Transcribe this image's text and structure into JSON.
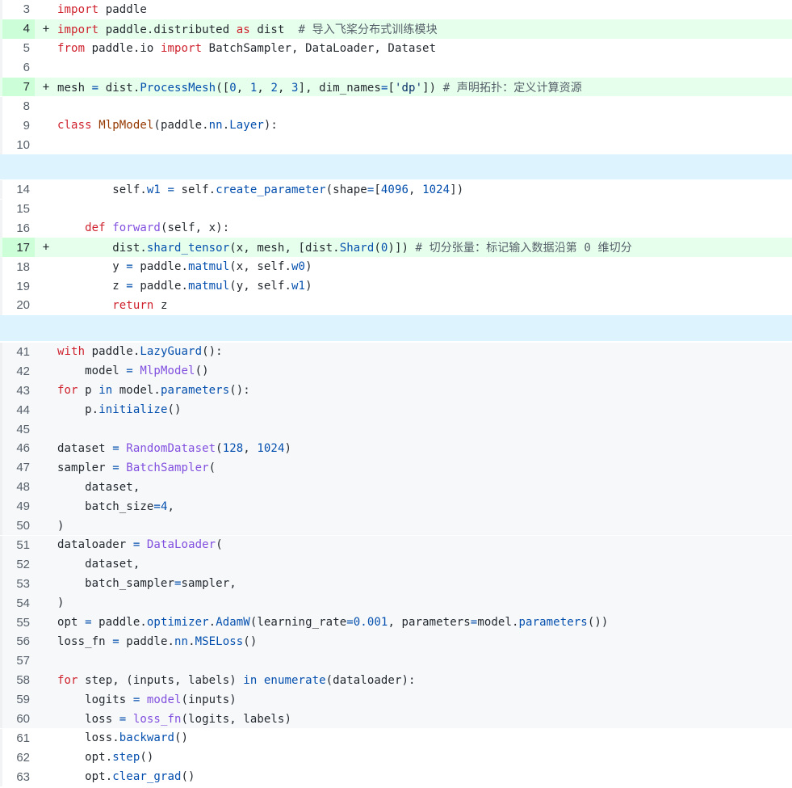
{
  "lines": [
    {
      "num": "3",
      "type": "ctx",
      "tokens": [
        {
          "t": "import",
          "c": "kw"
        },
        {
          "t": " paddle",
          "c": "ptxt"
        }
      ]
    },
    {
      "num": "4",
      "type": "add",
      "tokens": [
        {
          "t": "import",
          "c": "kw"
        },
        {
          "t": " paddle.distributed ",
          "c": "ptxt"
        },
        {
          "t": "as",
          "c": "kw"
        },
        {
          "t": " dist  ",
          "c": "ptxt"
        },
        {
          "t": "# 导入飞桨分布式训练模块",
          "c": "cm"
        }
      ]
    },
    {
      "num": "5",
      "type": "ctx",
      "tokens": [
        {
          "t": "from",
          "c": "kw"
        },
        {
          "t": " paddle.io ",
          "c": "ptxt"
        },
        {
          "t": "import",
          "c": "kw"
        },
        {
          "t": " BatchSampler, DataLoader, Dataset",
          "c": "ptxt"
        }
      ]
    },
    {
      "num": "6",
      "type": "ctx",
      "tokens": []
    },
    {
      "num": "7",
      "type": "add",
      "tokens": [
        {
          "t": "mesh ",
          "c": "ptxt"
        },
        {
          "t": "=",
          "c": "pr"
        },
        {
          "t": " dist.",
          "c": "ptxt"
        },
        {
          "t": "ProcessMesh",
          "c": "pr"
        },
        {
          "t": "([",
          "c": "ptxt"
        },
        {
          "t": "0",
          "c": "num-lit"
        },
        {
          "t": ", ",
          "c": "ptxt"
        },
        {
          "t": "1",
          "c": "num-lit"
        },
        {
          "t": ", ",
          "c": "ptxt"
        },
        {
          "t": "2",
          "c": "num-lit"
        },
        {
          "t": ", ",
          "c": "ptxt"
        },
        {
          "t": "3",
          "c": "num-lit"
        },
        {
          "t": "], dim_names",
          "c": "ptxt"
        },
        {
          "t": "=",
          "c": "pr"
        },
        {
          "t": "[",
          "c": "ptxt"
        },
        {
          "t": "'dp'",
          "c": "str"
        },
        {
          "t": "]) ",
          "c": "ptxt"
        },
        {
          "t": "# 声明拓扑：定义计算资源",
          "c": "cm"
        }
      ]
    },
    {
      "num": "8",
      "type": "ctx",
      "tokens": []
    },
    {
      "num": "9",
      "type": "ctx",
      "tokens": [
        {
          "t": "class",
          "c": "kw"
        },
        {
          "t": " ",
          "c": "ptxt"
        },
        {
          "t": "MlpModel",
          "c": "cls"
        },
        {
          "t": "(paddle.",
          "c": "ptxt"
        },
        {
          "t": "nn",
          "c": "pr"
        },
        {
          "t": ".",
          "c": "ptxt"
        },
        {
          "t": "Layer",
          "c": "pr"
        },
        {
          "t": "):",
          "c": "ptxt"
        }
      ]
    },
    {
      "num": "10",
      "type": "ctx",
      "tokens": []
    },
    {
      "num": "14",
      "type": "ctx",
      "tokens": [
        {
          "t": "        self.",
          "c": "ptxt"
        },
        {
          "t": "w1",
          "c": "pr"
        },
        {
          "t": " ",
          "c": "ptxt"
        },
        {
          "t": "=",
          "c": "pr"
        },
        {
          "t": " self.",
          "c": "ptxt"
        },
        {
          "t": "create_parameter",
          "c": "pr"
        },
        {
          "t": "(shape",
          "c": "ptxt"
        },
        {
          "t": "=",
          "c": "pr"
        },
        {
          "t": "[",
          "c": "ptxt"
        },
        {
          "t": "4096",
          "c": "num-lit"
        },
        {
          "t": ", ",
          "c": "ptxt"
        },
        {
          "t": "1024",
          "c": "num-lit"
        },
        {
          "t": "])",
          "c": "ptxt"
        }
      ]
    },
    {
      "num": "15",
      "type": "ctx",
      "tokens": []
    },
    {
      "num": "16",
      "type": "ctx",
      "tokens": [
        {
          "t": "    ",
          "c": "ptxt"
        },
        {
          "t": "def",
          "c": "kw"
        },
        {
          "t": " ",
          "c": "ptxt"
        },
        {
          "t": "forward",
          "c": "fn"
        },
        {
          "t": "(self, x):",
          "c": "ptxt"
        }
      ]
    },
    {
      "num": "17",
      "type": "add",
      "tokens": [
        {
          "t": "        dist.",
          "c": "ptxt"
        },
        {
          "t": "shard_tensor",
          "c": "pr"
        },
        {
          "t": "(x, mesh, [dist.",
          "c": "ptxt"
        },
        {
          "t": "Shard",
          "c": "pr"
        },
        {
          "t": "(",
          "c": "ptxt"
        },
        {
          "t": "0",
          "c": "num-lit"
        },
        {
          "t": ")]) ",
          "c": "ptxt"
        },
        {
          "t": "# 切分张量：标记输入数据沿第 0 维切分",
          "c": "cm"
        }
      ]
    },
    {
      "num": "18",
      "type": "ctx",
      "tokens": [
        {
          "t": "        y ",
          "c": "ptxt"
        },
        {
          "t": "=",
          "c": "pr"
        },
        {
          "t": " paddle.",
          "c": "ptxt"
        },
        {
          "t": "matmul",
          "c": "pr"
        },
        {
          "t": "(x, self.",
          "c": "ptxt"
        },
        {
          "t": "w0",
          "c": "pr"
        },
        {
          "t": ")",
          "c": "ptxt"
        }
      ]
    },
    {
      "num": "19",
      "type": "ctx",
      "tokens": [
        {
          "t": "        z ",
          "c": "ptxt"
        },
        {
          "t": "=",
          "c": "pr"
        },
        {
          "t": " paddle.",
          "c": "ptxt"
        },
        {
          "t": "matmul",
          "c": "pr"
        },
        {
          "t": "(y, self.",
          "c": "ptxt"
        },
        {
          "t": "w1",
          "c": "pr"
        },
        {
          "t": ")",
          "c": "ptxt"
        }
      ]
    },
    {
      "num": "20",
      "type": "ctx",
      "tokens": [
        {
          "t": "        ",
          "c": "ptxt"
        },
        {
          "t": "return",
          "c": "kw"
        },
        {
          "t": " z",
          "c": "ptxt"
        }
      ]
    },
    {
      "num": "41",
      "type": "ctx",
      "grey": true,
      "tokens": [
        {
          "t": "with",
          "c": "kw"
        },
        {
          "t": " paddle.",
          "c": "ptxt"
        },
        {
          "t": "LazyGuard",
          "c": "pr"
        },
        {
          "t": "():",
          "c": "ptxt"
        }
      ]
    },
    {
      "num": "42",
      "type": "ctx",
      "grey": true,
      "tokens": [
        {
          "t": "    model ",
          "c": "ptxt"
        },
        {
          "t": "=",
          "c": "pr"
        },
        {
          "t": " ",
          "c": "ptxt"
        },
        {
          "t": "MlpModel",
          "c": "fn"
        },
        {
          "t": "()",
          "c": "ptxt"
        }
      ]
    },
    {
      "num": "43",
      "type": "ctx",
      "grey": true,
      "tokens": [
        {
          "t": "for",
          "c": "kw"
        },
        {
          "t": " p ",
          "c": "ptxt"
        },
        {
          "t": "in",
          "c": "pr"
        },
        {
          "t": " model.",
          "c": "ptxt"
        },
        {
          "t": "parameters",
          "c": "pr"
        },
        {
          "t": "():",
          "c": "ptxt"
        }
      ]
    },
    {
      "num": "44",
      "type": "ctx",
      "grey": true,
      "tokens": [
        {
          "t": "    p.",
          "c": "ptxt"
        },
        {
          "t": "initialize",
          "c": "pr"
        },
        {
          "t": "()",
          "c": "ptxt"
        }
      ]
    },
    {
      "num": "45",
      "type": "ctx",
      "grey": true,
      "tokens": []
    },
    {
      "num": "46",
      "type": "ctx",
      "grey": true,
      "tokens": [
        {
          "t": "dataset ",
          "c": "ptxt"
        },
        {
          "t": "=",
          "c": "pr"
        },
        {
          "t": " ",
          "c": "ptxt"
        },
        {
          "t": "RandomDataset",
          "c": "fn"
        },
        {
          "t": "(",
          "c": "ptxt"
        },
        {
          "t": "128",
          "c": "num-lit"
        },
        {
          "t": ", ",
          "c": "ptxt"
        },
        {
          "t": "1024",
          "c": "num-lit"
        },
        {
          "t": ")",
          "c": "ptxt"
        }
      ]
    },
    {
      "num": "47",
      "type": "ctx",
      "grey": true,
      "tokens": [
        {
          "t": "sampler ",
          "c": "ptxt"
        },
        {
          "t": "=",
          "c": "pr"
        },
        {
          "t": " ",
          "c": "ptxt"
        },
        {
          "t": "BatchSampler",
          "c": "fn"
        },
        {
          "t": "(",
          "c": "ptxt"
        }
      ]
    },
    {
      "num": "48",
      "type": "ctx",
      "grey": true,
      "tokens": [
        {
          "t": "    dataset,",
          "c": "ptxt"
        }
      ]
    },
    {
      "num": "49",
      "type": "ctx",
      "grey": true,
      "tokens": [
        {
          "t": "    batch_size",
          "c": "ptxt"
        },
        {
          "t": "=",
          "c": "pr"
        },
        {
          "t": "4",
          "c": "num-lit"
        },
        {
          "t": ",",
          "c": "ptxt"
        }
      ]
    },
    {
      "num": "50",
      "type": "ctx",
      "grey": true,
      "tokens": [
        {
          "t": ")",
          "c": "ptxt"
        }
      ]
    },
    {
      "num": "51",
      "type": "ctx",
      "grey": true,
      "tokens": [
        {
          "t": "dataloader ",
          "c": "ptxt"
        },
        {
          "t": "=",
          "c": "pr"
        },
        {
          "t": " ",
          "c": "ptxt"
        },
        {
          "t": "DataLoader",
          "c": "fn"
        },
        {
          "t": "(",
          "c": "ptxt"
        }
      ]
    },
    {
      "num": "52",
      "type": "ctx",
      "grey": true,
      "tokens": [
        {
          "t": "    dataset,",
          "c": "ptxt"
        }
      ]
    },
    {
      "num": "53",
      "type": "ctx",
      "grey": true,
      "tokens": [
        {
          "t": "    batch_sampler",
          "c": "ptxt"
        },
        {
          "t": "=",
          "c": "pr"
        },
        {
          "t": "sampler,",
          "c": "ptxt"
        }
      ]
    },
    {
      "num": "54",
      "type": "ctx",
      "grey": true,
      "tokens": [
        {
          "t": ")",
          "c": "ptxt"
        }
      ]
    },
    {
      "num": "55",
      "type": "ctx",
      "grey": true,
      "tokens": [
        {
          "t": "opt ",
          "c": "ptxt"
        },
        {
          "t": "=",
          "c": "pr"
        },
        {
          "t": " paddle.",
          "c": "ptxt"
        },
        {
          "t": "optimizer",
          "c": "pr"
        },
        {
          "t": ".",
          "c": "ptxt"
        },
        {
          "t": "AdamW",
          "c": "pr"
        },
        {
          "t": "(learning_rate",
          "c": "ptxt"
        },
        {
          "t": "=",
          "c": "pr"
        },
        {
          "t": "0.001",
          "c": "num-lit"
        },
        {
          "t": ", parameters",
          "c": "ptxt"
        },
        {
          "t": "=",
          "c": "pr"
        },
        {
          "t": "model.",
          "c": "ptxt"
        },
        {
          "t": "parameters",
          "c": "pr"
        },
        {
          "t": "())",
          "c": "ptxt"
        }
      ]
    },
    {
      "num": "56",
      "type": "ctx",
      "grey": true,
      "tokens": [
        {
          "t": "loss_fn ",
          "c": "ptxt"
        },
        {
          "t": "=",
          "c": "pr"
        },
        {
          "t": " paddle.",
          "c": "ptxt"
        },
        {
          "t": "nn",
          "c": "pr"
        },
        {
          "t": ".",
          "c": "ptxt"
        },
        {
          "t": "MSELoss",
          "c": "pr"
        },
        {
          "t": "()",
          "c": "ptxt"
        }
      ]
    },
    {
      "num": "57",
      "type": "ctx",
      "grey": true,
      "tokens": []
    },
    {
      "num": "58",
      "type": "ctx",
      "grey": true,
      "tokens": [
        {
          "t": "for",
          "c": "kw"
        },
        {
          "t": " step, (inputs, labels) ",
          "c": "ptxt"
        },
        {
          "t": "in",
          "c": "pr"
        },
        {
          "t": " ",
          "c": "ptxt"
        },
        {
          "t": "enumerate",
          "c": "pr"
        },
        {
          "t": "(dataloader):",
          "c": "ptxt"
        }
      ]
    },
    {
      "num": "59",
      "type": "ctx",
      "grey": true,
      "tokens": [
        {
          "t": "    logits ",
          "c": "ptxt"
        },
        {
          "t": "=",
          "c": "pr"
        },
        {
          "t": " ",
          "c": "ptxt"
        },
        {
          "t": "model",
          "c": "fn"
        },
        {
          "t": "(inputs)",
          "c": "ptxt"
        }
      ]
    },
    {
      "num": "60",
      "type": "ctx",
      "grey": true,
      "tokens": [
        {
          "t": "    loss ",
          "c": "ptxt"
        },
        {
          "t": "=",
          "c": "pr"
        },
        {
          "t": " ",
          "c": "ptxt"
        },
        {
          "t": "loss_fn",
          "c": "fn"
        },
        {
          "t": "(logits, labels)",
          "c": "ptxt"
        }
      ]
    },
    {
      "num": "61",
      "type": "ctx",
      "tokens": [
        {
          "t": "    loss.",
          "c": "ptxt"
        },
        {
          "t": "backward",
          "c": "pr"
        },
        {
          "t": "()",
          "c": "ptxt"
        }
      ]
    },
    {
      "num": "62",
      "type": "ctx",
      "tokens": [
        {
          "t": "    opt.",
          "c": "ptxt"
        },
        {
          "t": "step",
          "c": "pr"
        },
        {
          "t": "()",
          "c": "ptxt"
        }
      ]
    },
    {
      "num": "63",
      "type": "ctx",
      "tokens": [
        {
          "t": "    opt.",
          "c": "ptxt"
        },
        {
          "t": "clear_grad",
          "c": "pr"
        },
        {
          "t": "()",
          "c": "ptxt"
        }
      ]
    }
  ],
  "add_marker": "+",
  "colors": {
    "added_bg": "#e6ffec",
    "added_num_bg": "#ccffd8",
    "hunk_bg": "#ddf4ff",
    "keyword": "#cf222e",
    "function": "#8250df",
    "property": "#0550ae",
    "class": "#953800",
    "comment": "#57606a"
  }
}
